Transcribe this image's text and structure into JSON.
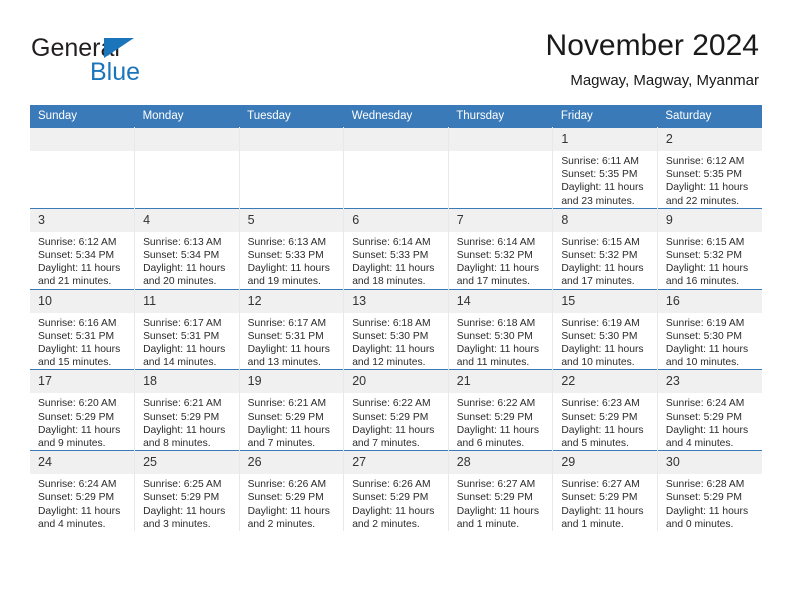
{
  "brand": {
    "name_top": "General",
    "name_bottom": "Blue",
    "accent_color": "#1b75bb"
  },
  "header": {
    "title": "November 2024",
    "subtitle": "Magway, Magway, Myanmar"
  },
  "theme": {
    "header_row_color": "#3a7ab8",
    "daynum_band_color": "#f0f0f0"
  },
  "weekday_headers": [
    "Sunday",
    "Monday",
    "Tuesday",
    "Wednesday",
    "Thursday",
    "Friday",
    "Saturday"
  ],
  "weeks": [
    [
      {
        "day": "",
        "blank": true
      },
      {
        "day": "",
        "blank": true
      },
      {
        "day": "",
        "blank": true
      },
      {
        "day": "",
        "blank": true
      },
      {
        "day": "",
        "blank": true
      },
      {
        "day": "1",
        "sunrise": "Sunrise: 6:11 AM",
        "sunset": "Sunset: 5:35 PM",
        "daylight_1": "Daylight: 11 hours",
        "daylight_2": "and 23 minutes."
      },
      {
        "day": "2",
        "sunrise": "Sunrise: 6:12 AM",
        "sunset": "Sunset: 5:35 PM",
        "daylight_1": "Daylight: 11 hours",
        "daylight_2": "and 22 minutes."
      }
    ],
    [
      {
        "day": "3",
        "sunrise": "Sunrise: 6:12 AM",
        "sunset": "Sunset: 5:34 PM",
        "daylight_1": "Daylight: 11 hours",
        "daylight_2": "and 21 minutes."
      },
      {
        "day": "4",
        "sunrise": "Sunrise: 6:13 AM",
        "sunset": "Sunset: 5:34 PM",
        "daylight_1": "Daylight: 11 hours",
        "daylight_2": "and 20 minutes."
      },
      {
        "day": "5",
        "sunrise": "Sunrise: 6:13 AM",
        "sunset": "Sunset: 5:33 PM",
        "daylight_1": "Daylight: 11 hours",
        "daylight_2": "and 19 minutes."
      },
      {
        "day": "6",
        "sunrise": "Sunrise: 6:14 AM",
        "sunset": "Sunset: 5:33 PM",
        "daylight_1": "Daylight: 11 hours",
        "daylight_2": "and 18 minutes."
      },
      {
        "day": "7",
        "sunrise": "Sunrise: 6:14 AM",
        "sunset": "Sunset: 5:32 PM",
        "daylight_1": "Daylight: 11 hours",
        "daylight_2": "and 17 minutes."
      },
      {
        "day": "8",
        "sunrise": "Sunrise: 6:15 AM",
        "sunset": "Sunset: 5:32 PM",
        "daylight_1": "Daylight: 11 hours",
        "daylight_2": "and 17 minutes."
      },
      {
        "day": "9",
        "sunrise": "Sunrise: 6:15 AM",
        "sunset": "Sunset: 5:32 PM",
        "daylight_1": "Daylight: 11 hours",
        "daylight_2": "and 16 minutes."
      }
    ],
    [
      {
        "day": "10",
        "sunrise": "Sunrise: 6:16 AM",
        "sunset": "Sunset: 5:31 PM",
        "daylight_1": "Daylight: 11 hours",
        "daylight_2": "and 15 minutes."
      },
      {
        "day": "11",
        "sunrise": "Sunrise: 6:17 AM",
        "sunset": "Sunset: 5:31 PM",
        "daylight_1": "Daylight: 11 hours",
        "daylight_2": "and 14 minutes."
      },
      {
        "day": "12",
        "sunrise": "Sunrise: 6:17 AM",
        "sunset": "Sunset: 5:31 PM",
        "daylight_1": "Daylight: 11 hours",
        "daylight_2": "and 13 minutes."
      },
      {
        "day": "13",
        "sunrise": "Sunrise: 6:18 AM",
        "sunset": "Sunset: 5:30 PM",
        "daylight_1": "Daylight: 11 hours",
        "daylight_2": "and 12 minutes."
      },
      {
        "day": "14",
        "sunrise": "Sunrise: 6:18 AM",
        "sunset": "Sunset: 5:30 PM",
        "daylight_1": "Daylight: 11 hours",
        "daylight_2": "and 11 minutes."
      },
      {
        "day": "15",
        "sunrise": "Sunrise: 6:19 AM",
        "sunset": "Sunset: 5:30 PM",
        "daylight_1": "Daylight: 11 hours",
        "daylight_2": "and 10 minutes."
      },
      {
        "day": "16",
        "sunrise": "Sunrise: 6:19 AM",
        "sunset": "Sunset: 5:30 PM",
        "daylight_1": "Daylight: 11 hours",
        "daylight_2": "and 10 minutes."
      }
    ],
    [
      {
        "day": "17",
        "sunrise": "Sunrise: 6:20 AM",
        "sunset": "Sunset: 5:29 PM",
        "daylight_1": "Daylight: 11 hours",
        "daylight_2": "and 9 minutes."
      },
      {
        "day": "18",
        "sunrise": "Sunrise: 6:21 AM",
        "sunset": "Sunset: 5:29 PM",
        "daylight_1": "Daylight: 11 hours",
        "daylight_2": "and 8 minutes."
      },
      {
        "day": "19",
        "sunrise": "Sunrise: 6:21 AM",
        "sunset": "Sunset: 5:29 PM",
        "daylight_1": "Daylight: 11 hours",
        "daylight_2": "and 7 minutes."
      },
      {
        "day": "20",
        "sunrise": "Sunrise: 6:22 AM",
        "sunset": "Sunset: 5:29 PM",
        "daylight_1": "Daylight: 11 hours",
        "daylight_2": "and 7 minutes."
      },
      {
        "day": "21",
        "sunrise": "Sunrise: 6:22 AM",
        "sunset": "Sunset: 5:29 PM",
        "daylight_1": "Daylight: 11 hours",
        "daylight_2": "and 6 minutes."
      },
      {
        "day": "22",
        "sunrise": "Sunrise: 6:23 AM",
        "sunset": "Sunset: 5:29 PM",
        "daylight_1": "Daylight: 11 hours",
        "daylight_2": "and 5 minutes."
      },
      {
        "day": "23",
        "sunrise": "Sunrise: 6:24 AM",
        "sunset": "Sunset: 5:29 PM",
        "daylight_1": "Daylight: 11 hours",
        "daylight_2": "and 4 minutes."
      }
    ],
    [
      {
        "day": "24",
        "sunrise": "Sunrise: 6:24 AM",
        "sunset": "Sunset: 5:29 PM",
        "daylight_1": "Daylight: 11 hours",
        "daylight_2": "and 4 minutes."
      },
      {
        "day": "25",
        "sunrise": "Sunrise: 6:25 AM",
        "sunset": "Sunset: 5:29 PM",
        "daylight_1": "Daylight: 11 hours",
        "daylight_2": "and 3 minutes."
      },
      {
        "day": "26",
        "sunrise": "Sunrise: 6:26 AM",
        "sunset": "Sunset: 5:29 PM",
        "daylight_1": "Daylight: 11 hours",
        "daylight_2": "and 2 minutes."
      },
      {
        "day": "27",
        "sunrise": "Sunrise: 6:26 AM",
        "sunset": "Sunset: 5:29 PM",
        "daylight_1": "Daylight: 11 hours",
        "daylight_2": "and 2 minutes."
      },
      {
        "day": "28",
        "sunrise": "Sunrise: 6:27 AM",
        "sunset": "Sunset: 5:29 PM",
        "daylight_1": "Daylight: 11 hours",
        "daylight_2": "and 1 minute."
      },
      {
        "day": "29",
        "sunrise": "Sunrise: 6:27 AM",
        "sunset": "Sunset: 5:29 PM",
        "daylight_1": "Daylight: 11 hours",
        "daylight_2": "and 1 minute."
      },
      {
        "day": "30",
        "sunrise": "Sunrise: 6:28 AM",
        "sunset": "Sunset: 5:29 PM",
        "daylight_1": "Daylight: 11 hours",
        "daylight_2": "and 0 minutes."
      }
    ]
  ]
}
